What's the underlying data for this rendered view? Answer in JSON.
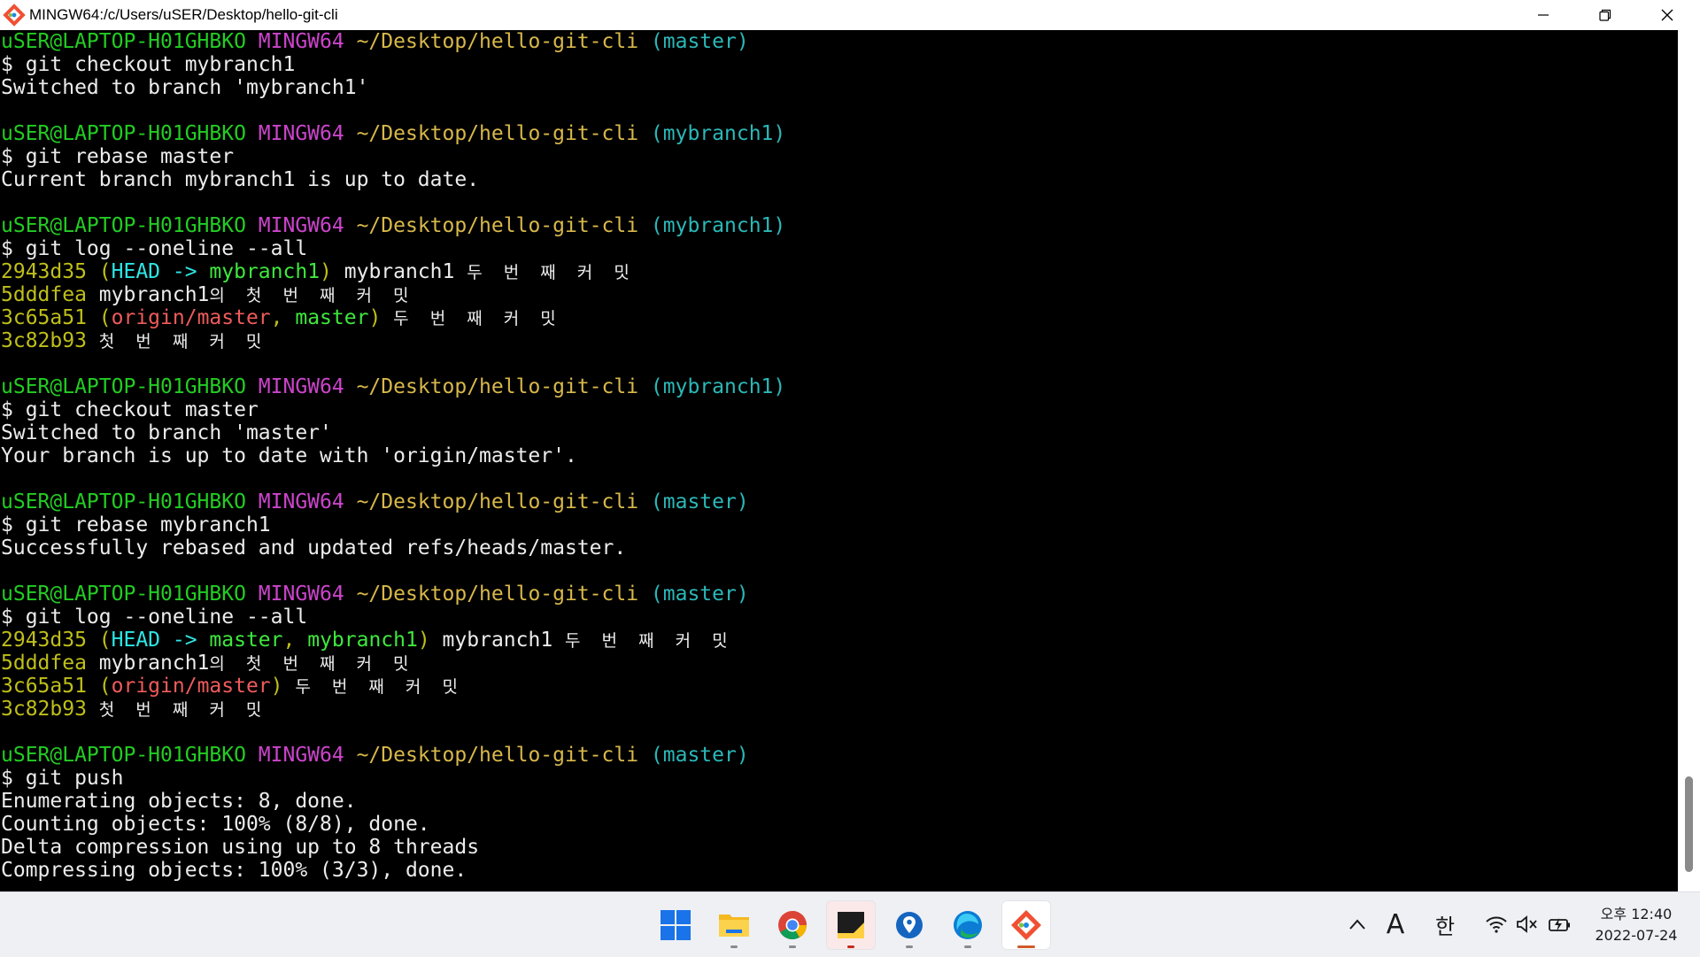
{
  "window": {
    "title": "MINGW64:/c/Users/uSER/Desktop/hello-git-cli"
  },
  "terminal": {
    "lines": [
      [
        [
          "uSER@LAPTOP-H01GHBKO ",
          "green"
        ],
        [
          "MINGW64 ",
          "magenta"
        ],
        [
          "~/Desktop/hello-git-cli ",
          "yellow"
        ],
        [
          "(master)",
          "cyan"
        ]
      ],
      [
        [
          "$ git checkout mybranch1",
          "white"
        ]
      ],
      [
        [
          "Switched to branch 'mybranch1'",
          "white"
        ]
      ],
      [],
      [
        [
          "uSER@LAPTOP-H01GHBKO ",
          "green"
        ],
        [
          "MINGW64 ",
          "magenta"
        ],
        [
          "~/Desktop/hello-git-cli ",
          "yellow"
        ],
        [
          "(mybranch1)",
          "cyan"
        ]
      ],
      [
        [
          "$ git rebase master",
          "white"
        ]
      ],
      [
        [
          "Current branch mybranch1 is up to date.",
          "white"
        ]
      ],
      [],
      [
        [
          "uSER@LAPTOP-H01GHBKO ",
          "green"
        ],
        [
          "MINGW64 ",
          "magenta"
        ],
        [
          "~/Desktop/hello-git-cli ",
          "yellow"
        ],
        [
          "(mybranch1)",
          "cyan"
        ]
      ],
      [
        [
          "$ git log --oneline --all",
          "white"
        ]
      ],
      [
        [
          "2943d35 ",
          "olive"
        ],
        [
          "(",
          "olive"
        ],
        [
          "HEAD -> ",
          "bcyan"
        ],
        [
          "mybranch1",
          "bgreen"
        ],
        [
          ")",
          "olive"
        ],
        [
          " mybranch1 ",
          "white"
        ],
        [
          "두 번 째 커 밋",
          "ko"
        ]
      ],
      [
        [
          "5dddfea ",
          "olive"
        ],
        [
          "mybranch1",
          "white"
        ],
        [
          "의 첫 번 째 커 밋",
          "ko"
        ]
      ],
      [
        [
          "3c65a51 ",
          "olive"
        ],
        [
          "(",
          "olive"
        ],
        [
          "origin/master",
          "red"
        ],
        [
          ", ",
          "olive"
        ],
        [
          "master",
          "bgreen"
        ],
        [
          ")",
          "olive"
        ],
        [
          " ",
          "white"
        ],
        [
          "두 번 째 커 밋",
          "ko"
        ]
      ],
      [
        [
          "3c82b93 ",
          "olive"
        ],
        [
          "첫 번 째 커 밋",
          "ko"
        ]
      ],
      [],
      [
        [
          "uSER@LAPTOP-H01GHBKO ",
          "green"
        ],
        [
          "MINGW64 ",
          "magenta"
        ],
        [
          "~/Desktop/hello-git-cli ",
          "yellow"
        ],
        [
          "(mybranch1)",
          "cyan"
        ]
      ],
      [
        [
          "$ git checkout master",
          "white"
        ]
      ],
      [
        [
          "Switched to branch 'master'",
          "white"
        ]
      ],
      [
        [
          "Your branch is up to date with 'origin/master'.",
          "white"
        ]
      ],
      [],
      [
        [
          "uSER@LAPTOP-H01GHBKO ",
          "green"
        ],
        [
          "MINGW64 ",
          "magenta"
        ],
        [
          "~/Desktop/hello-git-cli ",
          "yellow"
        ],
        [
          "(master)",
          "cyan"
        ]
      ],
      [
        [
          "$ git rebase mybranch1",
          "white"
        ]
      ],
      [
        [
          "Successfully rebased and updated refs/heads/master.",
          "white"
        ]
      ],
      [],
      [
        [
          "uSER@LAPTOP-H01GHBKO ",
          "green"
        ],
        [
          "MINGW64 ",
          "magenta"
        ],
        [
          "~/Desktop/hello-git-cli ",
          "yellow"
        ],
        [
          "(master)",
          "cyan"
        ]
      ],
      [
        [
          "$ git log --oneline --all",
          "white"
        ]
      ],
      [
        [
          "2943d35 ",
          "olive"
        ],
        [
          "(",
          "olive"
        ],
        [
          "HEAD -> ",
          "bcyan"
        ],
        [
          "master",
          "bgreen"
        ],
        [
          ", ",
          "olive"
        ],
        [
          "mybranch1",
          "bgreen"
        ],
        [
          ")",
          "olive"
        ],
        [
          " mybranch1 ",
          "white"
        ],
        [
          "두 번 째 커 밋",
          "ko"
        ]
      ],
      [
        [
          "5dddfea ",
          "olive"
        ],
        [
          "mybranch1",
          "white"
        ],
        [
          "의 첫 번 째 커 밋",
          "ko"
        ]
      ],
      [
        [
          "3c65a51 ",
          "olive"
        ],
        [
          "(",
          "olive"
        ],
        [
          "origin/master",
          "red"
        ],
        [
          ")",
          "olive"
        ],
        [
          " ",
          "white"
        ],
        [
          "두 번 째 커 밋",
          "ko"
        ]
      ],
      [
        [
          "3c82b93 ",
          "olive"
        ],
        [
          "첫 번 째 커 밋",
          "ko"
        ]
      ],
      [],
      [
        [
          "uSER@LAPTOP-H01GHBKO ",
          "green"
        ],
        [
          "MINGW64 ",
          "magenta"
        ],
        [
          "~/Desktop/hello-git-cli ",
          "yellow"
        ],
        [
          "(master)",
          "cyan"
        ]
      ],
      [
        [
          "$ git push",
          "white"
        ]
      ],
      [
        [
          "Enumerating objects: 8, done.",
          "white"
        ]
      ],
      [
        [
          "Counting objects: 100% (8/8), done.",
          "white"
        ]
      ],
      [
        [
          "Delta compression using up to 8 threads",
          "white"
        ]
      ],
      [
        [
          "Compressing objects: 100% (3/3), done.",
          "white"
        ]
      ]
    ]
  },
  "taskbar": {
    "apps": [
      {
        "name": "windows-start-icon"
      },
      {
        "name": "file-explorer-icon"
      },
      {
        "name": "chrome-icon"
      },
      {
        "name": "sticky-notes-icon"
      },
      {
        "name": "maps-pin-icon"
      },
      {
        "name": "edge-icon"
      },
      {
        "name": "git-bash-icon"
      }
    ],
    "tray": {
      "chevron": "^",
      "ime_a": "A",
      "ime_han": "한"
    },
    "clock": {
      "time": "오후 12:40",
      "date": "2022-07-24"
    }
  },
  "colors": {
    "green": "#23cc23",
    "magenta": "#cc44cc",
    "yellow": "#d8b84a",
    "cyan": "#2cb8b8",
    "olive": "#bfbf1a",
    "bcyan": "#2ee6e6",
    "bgreen": "#3ee83e",
    "red": "#ef5b5b",
    "white": "#ececec"
  }
}
